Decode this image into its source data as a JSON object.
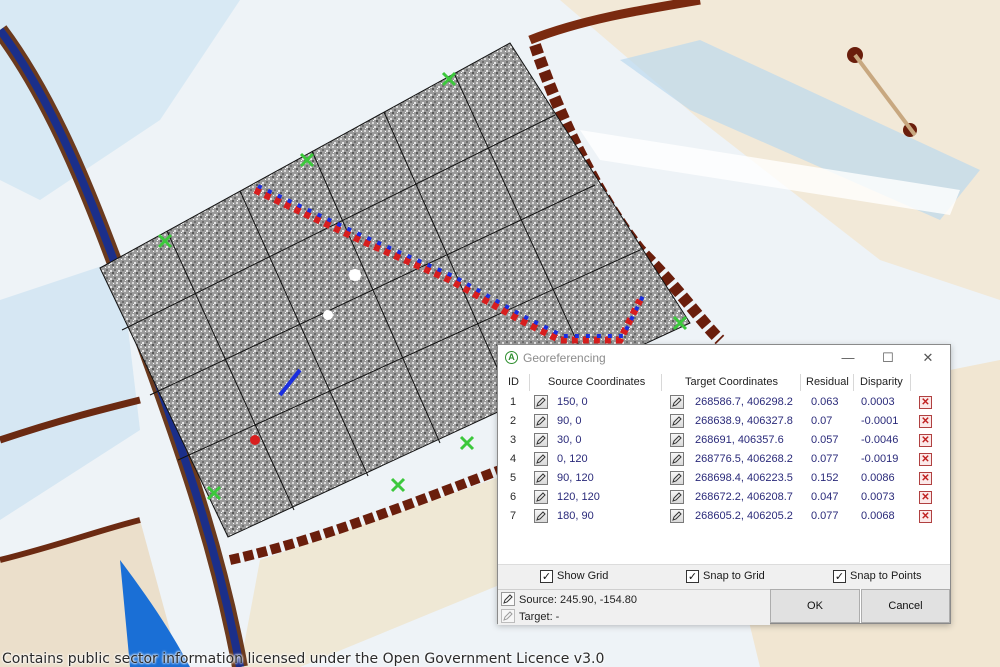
{
  "dialog": {
    "title": "Georeferencing",
    "app_icon_letter": "A",
    "window_controls": {
      "minimize": "—",
      "maximize": "☐",
      "close": "✕"
    },
    "columns": [
      "ID",
      "Source Coordinates",
      "Target Coordinates",
      "Residual",
      "Disparity"
    ],
    "rows": [
      {
        "id": "1",
        "source": "150, 0",
        "target": "268586.7, 406298.2",
        "residual": "0.063",
        "disparity": "0.0003"
      },
      {
        "id": "2",
        "source": "90, 0",
        "target": "268638.9, 406327.8",
        "residual": "0.07",
        "disparity": "-0.0001"
      },
      {
        "id": "3",
        "source": "30, 0",
        "target": "268691, 406357.6",
        "residual": "0.057",
        "disparity": "-0.0046"
      },
      {
        "id": "4",
        "source": "0, 120",
        "target": "268776.5, 406268.2",
        "residual": "0.077",
        "disparity": "-0.0019"
      },
      {
        "id": "5",
        "source": "90, 120",
        "target": "268698.4, 406223.5",
        "residual": "0.152",
        "disparity": "0.0086"
      },
      {
        "id": "6",
        "source": "120, 120",
        "target": "268672.2, 406208.7",
        "residual": "0.047",
        "disparity": "0.0073"
      },
      {
        "id": "7",
        "source": "180, 90",
        "target": "268605.2, 406205.2",
        "residual": "0.077",
        "disparity": "0.0068"
      }
    ],
    "options": {
      "show_grid": {
        "label": "Show Grid",
        "checked": true
      },
      "snap_to_grid": {
        "label": "Snap to Grid",
        "checked": true
      },
      "snap_to_points": {
        "label": "Snap to Points",
        "checked": true
      }
    },
    "status": {
      "source_text": "Source: 245.90, -154.80",
      "target_text": "Target: -"
    },
    "buttons": {
      "ok": "OK",
      "cancel": "Cancel"
    }
  },
  "icons": {
    "row_edit": "pencil-icon",
    "row_delete": "delete-x-icon",
    "app": "app-logo-icon"
  },
  "colors": {
    "gcp_marker": "#3cc83c",
    "app_accent": "#2f8f2f",
    "delete_red": "#c02020",
    "anomaly_red": "#d81e1e",
    "anomaly_blue": "#1a2ee0"
  },
  "map": {
    "credit": "Contains public sector information licensed under the Open Government Licence v3.0"
  }
}
